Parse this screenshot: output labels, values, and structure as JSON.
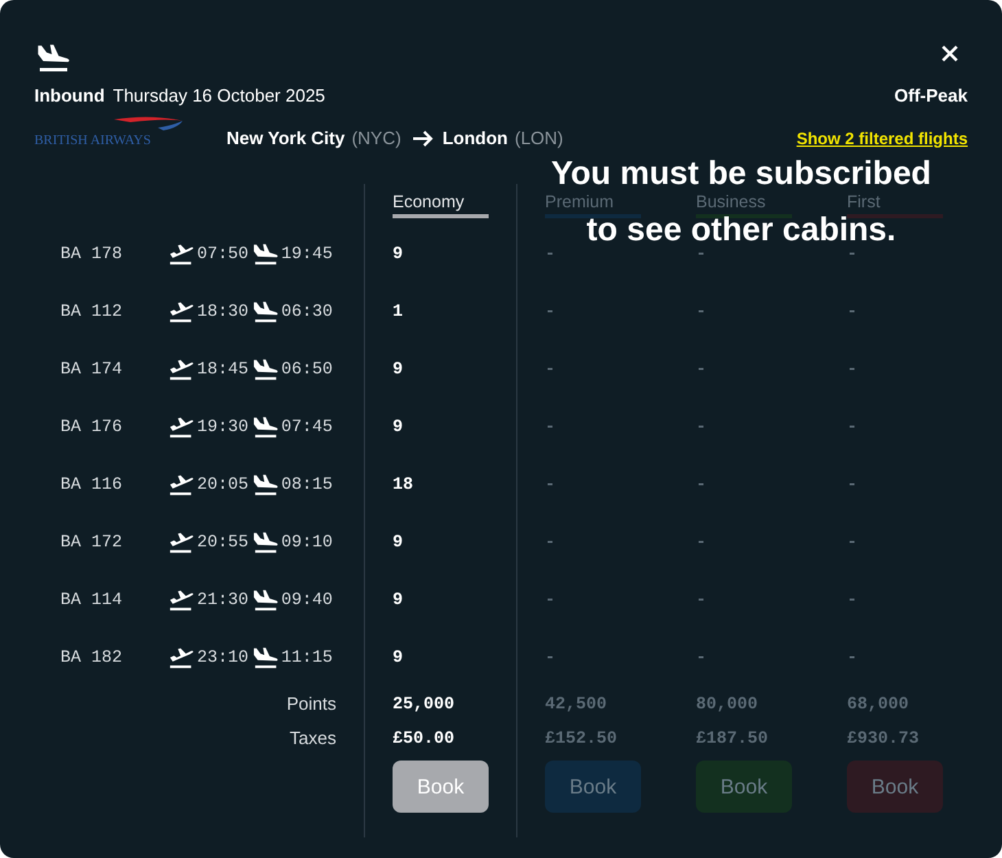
{
  "header": {
    "direction": "Inbound",
    "date": "Thursday 16 October 2025",
    "fare_type": "Off-Peak",
    "airline": "BRITISH AIRWAYS",
    "origin": {
      "city": "New York City",
      "code": "(NYC)"
    },
    "destination": {
      "city": "London",
      "code": "(LON)"
    },
    "filter_link": "Show 2 filtered flights"
  },
  "cabins": [
    {
      "name": "Economy",
      "color": "#a7a9ad",
      "disabled": false,
      "points": "25,000",
      "taxes": "£50.00",
      "button": "Book"
    },
    {
      "name": "Premium",
      "color": "#0e2a40",
      "disabled": true,
      "points": "42,500",
      "taxes": "£152.50",
      "button": "Book"
    },
    {
      "name": "Business",
      "color": "#13301f",
      "disabled": true,
      "points": "80,000",
      "taxes": "£187.50",
      "button": "Book"
    },
    {
      "name": "First",
      "color": "#2e1a22",
      "disabled": true,
      "points": "68,000",
      "taxes": "£930.73",
      "button": "Book"
    }
  ],
  "flights": [
    {
      "number": "BA 178",
      "departs": "07:50",
      "arrives": "19:45",
      "seats": [
        "9",
        "-",
        "-",
        "-"
      ]
    },
    {
      "number": "BA 112",
      "departs": "18:30",
      "arrives": "06:30",
      "seats": [
        "1",
        "-",
        "-",
        "-"
      ]
    },
    {
      "number": "BA 174",
      "departs": "18:45",
      "arrives": "06:50",
      "seats": [
        "9",
        "-",
        "-",
        "-"
      ]
    },
    {
      "number": "BA 176",
      "departs": "19:30",
      "arrives": "07:45",
      "seats": [
        "9",
        "-",
        "-",
        "-"
      ]
    },
    {
      "number": "BA 116",
      "departs": "20:05",
      "arrives": "08:15",
      "seats": [
        "18",
        "-",
        "-",
        "-"
      ]
    },
    {
      "number": "BA 172",
      "departs": "20:55",
      "arrives": "09:10",
      "seats": [
        "9",
        "-",
        "-",
        "-"
      ]
    },
    {
      "number": "BA 114",
      "departs": "21:30",
      "arrives": "09:40",
      "seats": [
        "9",
        "-",
        "-",
        "-"
      ]
    },
    {
      "number": "BA 182",
      "departs": "23:10",
      "arrives": "11:15",
      "seats": [
        "9",
        "-",
        "-",
        "-"
      ]
    }
  ],
  "labels": {
    "points": "Points",
    "taxes": "Taxes"
  },
  "overlay": [
    "You must be subscribed",
    "to see other cabins."
  ]
}
